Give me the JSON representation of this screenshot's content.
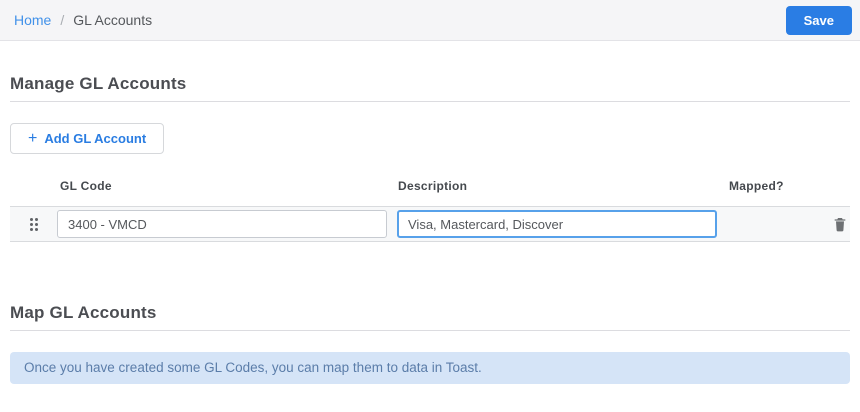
{
  "breadcrumb": {
    "home": "Home",
    "separator": "/",
    "current": "GL Accounts"
  },
  "toolbar": {
    "save_label": "Save"
  },
  "manage_section": {
    "title": "Manage GL Accounts",
    "add_button": {
      "plus": "+",
      "label": "Add GL Account"
    },
    "table": {
      "headers": [
        "GL Code",
        "Description",
        "Mapped?"
      ],
      "rows": [
        {
          "gl_code": "3400 - VMCD",
          "description": "Visa, Mastercard, Discover",
          "mapped": ""
        }
      ]
    }
  },
  "map_section": {
    "title": "Map GL Accounts",
    "info_message": "Once you have created some GL Codes, you can map them to data in Toast."
  },
  "colors": {
    "primary_blue": "#2a7de4",
    "link_blue": "#4191e9",
    "focus_border_blue": "#57a1ea",
    "alert_background": "#d5e4f7",
    "alert_text": "#5b7da9",
    "topbar_background": "#f5f5f7",
    "row_background": "#f7f8f9"
  }
}
